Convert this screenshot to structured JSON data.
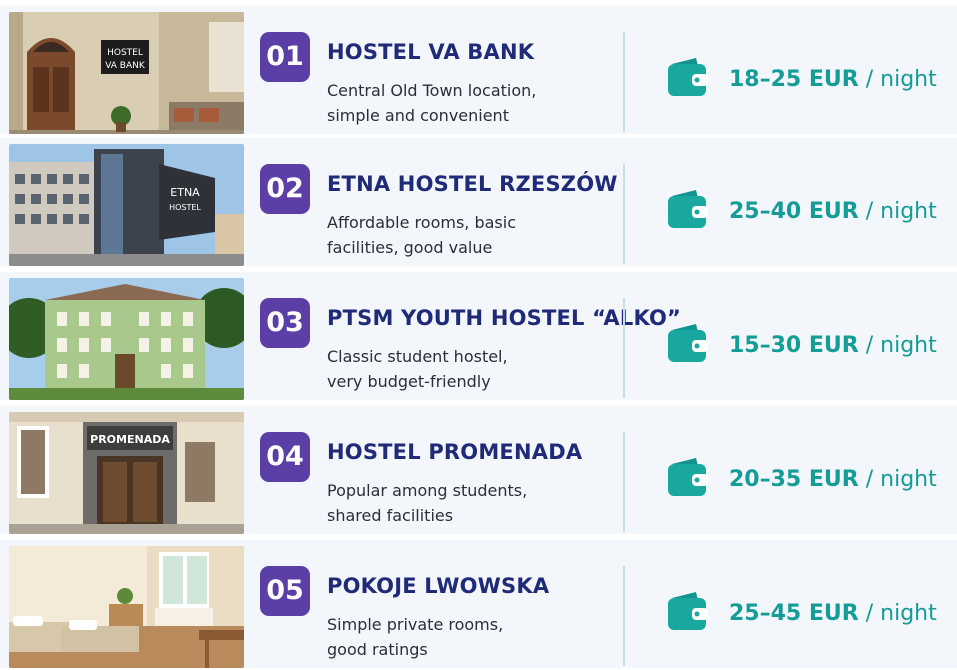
{
  "hostels": [
    {
      "number": "01",
      "name": "HOSTEL VA BANK",
      "description_line1": "Central Old Town location,",
      "description_line2": "simple and convenient",
      "price_amount": "18–25 EUR",
      "price_unit": "/ night",
      "photo_sign": [
        "HOSTEL",
        "VA BANK"
      ]
    },
    {
      "number": "02",
      "name": "ETNA HOSTEL RZESZÓW",
      "description_line1": "Affordable rooms, basic",
      "description_line2": "facilities, good value",
      "price_amount": "25–40 EUR",
      "price_unit": "/ night",
      "photo_sign": [
        "ETNA",
        "HOSTEL"
      ]
    },
    {
      "number": "03",
      "name": "PTSM YOUTH HOSTEL “ALKO”",
      "description_line1": "Classic student hostel,",
      "description_line2": "very budget-friendly",
      "price_amount": "15–30 EUR",
      "price_unit": "/ night"
    },
    {
      "number": "04",
      "name": "HOSTEL PROMENADA",
      "description_line1": "Popular among students,",
      "description_line2": "shared facilities",
      "price_amount": "20–35 EUR",
      "price_unit": "/ night",
      "photo_sign": [
        "PROMENADA"
      ]
    },
    {
      "number": "05",
      "name": "POKOJE LWOWSKA",
      "description_line1": "Simple private rooms,",
      "description_line2": "good ratings",
      "price_amount": "25–45 EUR",
      "price_unit": "/ night"
    }
  ],
  "icons": {
    "price": "wallet-icon"
  },
  "colors": {
    "badge": "#5b3ea6",
    "name": "#1f2a78",
    "price": "#149c96",
    "card_bg": "#f3f6fb"
  }
}
